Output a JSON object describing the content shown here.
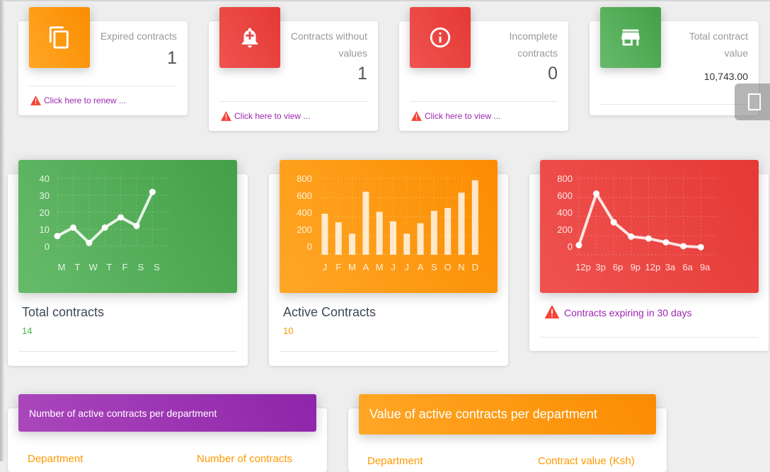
{
  "stats": [
    {
      "label": "Expired contracts",
      "value": "1",
      "footer": "Click here to renew ...",
      "icon": "copy-icon",
      "color": "#fb8c00"
    },
    {
      "label": "Contracts without values",
      "value": "1",
      "footer": "Click here to view ...",
      "icon": "bell-plus-icon",
      "color": "#e53935"
    },
    {
      "label": "Incomplete contracts",
      "value": "0",
      "footer": "Click here to view ...",
      "icon": "info-icon",
      "color": "#e53935"
    },
    {
      "label": "Total contract value",
      "value": "10,743.00",
      "icon": "store-icon",
      "color": "#43a047"
    }
  ],
  "charts": {
    "total": {
      "title": "Total contracts",
      "count": "14"
    },
    "active": {
      "title": "Active Contracts",
      "count": "10"
    },
    "expiring": {
      "footer": "Contracts expiring in 30 days"
    }
  },
  "chart_data": [
    {
      "type": "line",
      "categories": [
        "M",
        "T",
        "W",
        "T",
        "F",
        "S",
        "S"
      ],
      "values": [
        6,
        11,
        2,
        11,
        17,
        12,
        32
      ],
      "ylim": [
        0,
        40
      ],
      "yticks": [
        "40",
        "30",
        "20",
        "10",
        "0"
      ],
      "color": "#43a047"
    },
    {
      "type": "bar",
      "categories": [
        "J",
        "F",
        "M",
        "A",
        "M",
        "J",
        "J",
        "A",
        "S",
        "O",
        "N",
        "D"
      ],
      "values": [
        430,
        340,
        220,
        660,
        450,
        350,
        220,
        330,
        460,
        490,
        650,
        780
      ],
      "ylim": [
        0,
        800
      ],
      "yticks": [
        "800",
        "600",
        "400",
        "200",
        "0"
      ],
      "color": "#fb8c00"
    },
    {
      "type": "line",
      "categories": [
        "12p",
        "3p",
        "6p",
        "9p",
        "12p",
        "3a",
        "6a",
        "9a"
      ],
      "values": [
        100,
        640,
        340,
        190,
        170,
        130,
        90,
        80
      ],
      "ylim": [
        0,
        800
      ],
      "yticks": [
        "800",
        "600",
        "400",
        "200",
        "0"
      ],
      "color": "#e53935"
    }
  ],
  "tables": {
    "count": {
      "title": "Number of active contracts per department",
      "col1": "Department",
      "col2": "Number of contracts"
    },
    "value": {
      "title": "Value of active contracts per department",
      "col1": "Department",
      "col2": "Contract value (Ksh)"
    }
  }
}
